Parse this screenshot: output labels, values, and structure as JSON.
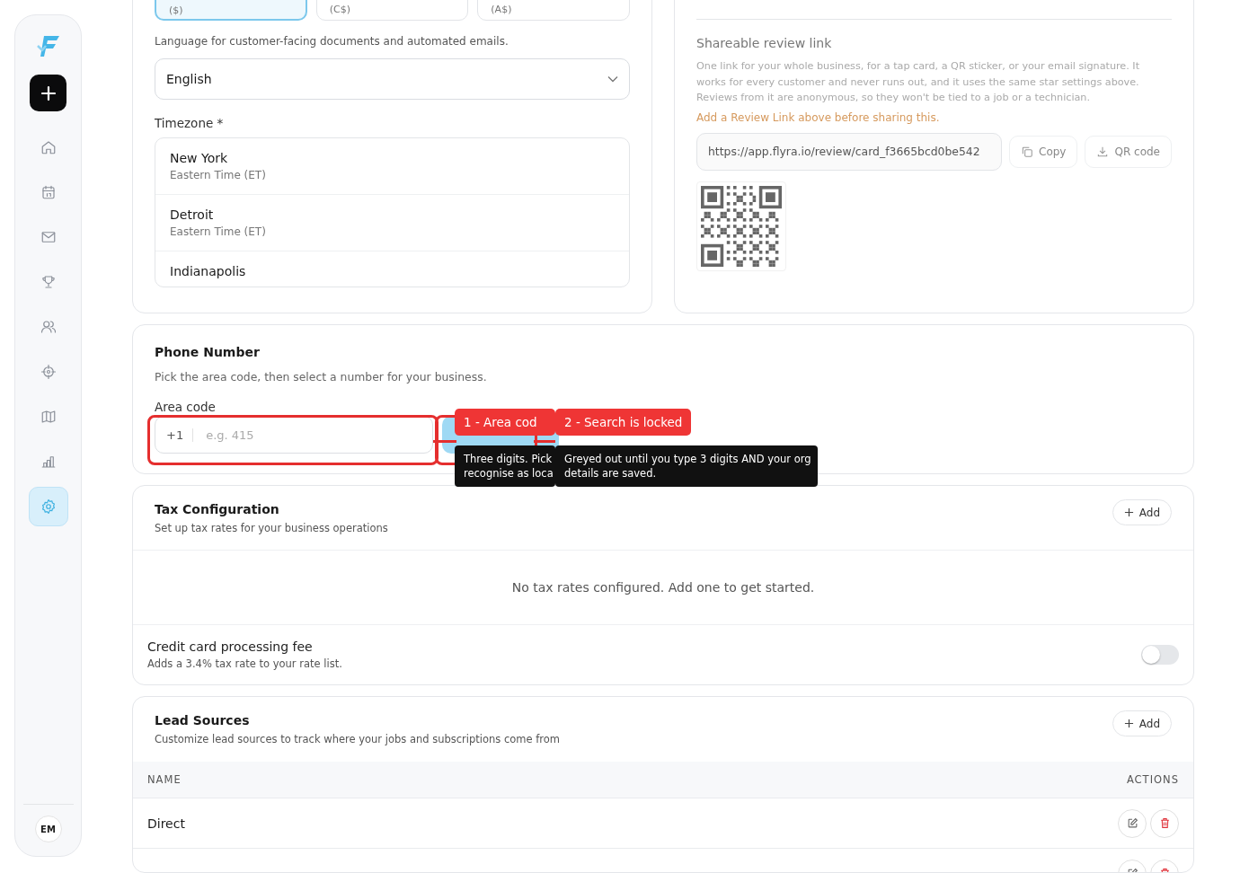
{
  "sidebar": {
    "items": [
      {
        "kind": "home",
        "selected": false
      },
      {
        "kind": "calendar",
        "selected": false
      },
      {
        "kind": "mail",
        "selected": false
      },
      {
        "kind": "trophy",
        "selected": false
      },
      {
        "kind": "users",
        "selected": false
      },
      {
        "kind": "target",
        "selected": false
      },
      {
        "kind": "map",
        "selected": false
      },
      {
        "kind": "chart",
        "selected": false
      },
      {
        "kind": "settings",
        "selected": true
      }
    ],
    "avatar": "EM"
  },
  "currency_options": [
    {
      "label": "($)",
      "selected": true
    },
    {
      "label": "(C$)",
      "selected": false
    },
    {
      "label": "(A$)",
      "selected": false
    }
  ],
  "language": {
    "hint": "Language for customer-facing documents and automated emails.",
    "value": "English"
  },
  "timezone": {
    "label": "Timezone *",
    "options": [
      {
        "city": "New York",
        "zone": "Eastern Time (ET)"
      },
      {
        "city": "Detroit",
        "zone": "Eastern Time (ET)"
      },
      {
        "city": "Indianapolis"
      }
    ]
  },
  "review_link": {
    "heading": "Shareable review link",
    "description": "One link for your whole business, for a tap card, a QR sticker, or your email signature. It works for every customer and never runs out, and it uses the same star settings above. Reviews from it are anonymous, so they won't be tied to a job or a technician.",
    "warning": "Add a Review Link above before sharing this.",
    "url": "https://app.flyra.io/review/card_f3665bcd0be542",
    "copy": "Copy",
    "qr": "QR code"
  },
  "phone": {
    "title": "Phone Number",
    "description": "Pick the area code, then select a number for your business.",
    "area_label": "Area code",
    "prefix": "+1",
    "placeholder": "e.g. 415",
    "callouts": [
      {
        "label": "1 - Area cod",
        "tip": [
          "Three digits. Pick",
          "recognise as loca"
        ]
      },
      {
        "label": "2 - Search is locked",
        "tip": [
          "Greyed out until you type 3 digits AND your org",
          "details are saved."
        ]
      }
    ]
  },
  "tax": {
    "title": "Tax Configuration",
    "subtitle": "Set up tax rates for your business operations",
    "add": "Add",
    "empty": "No tax rates configured. Add one to get started.",
    "fee_title": "Credit card processing fee",
    "fee_description": "Adds a 3.4% tax rate to your rate list.",
    "fee_on": false
  },
  "leads": {
    "title": "Lead Sources",
    "subtitle": "Customize lead sources to track where your jobs and subscriptions come from",
    "add": "Add",
    "columns": [
      "NAME",
      "ACTIONS"
    ],
    "rows": [
      {
        "name": "Direct"
      },
      {}
    ]
  }
}
